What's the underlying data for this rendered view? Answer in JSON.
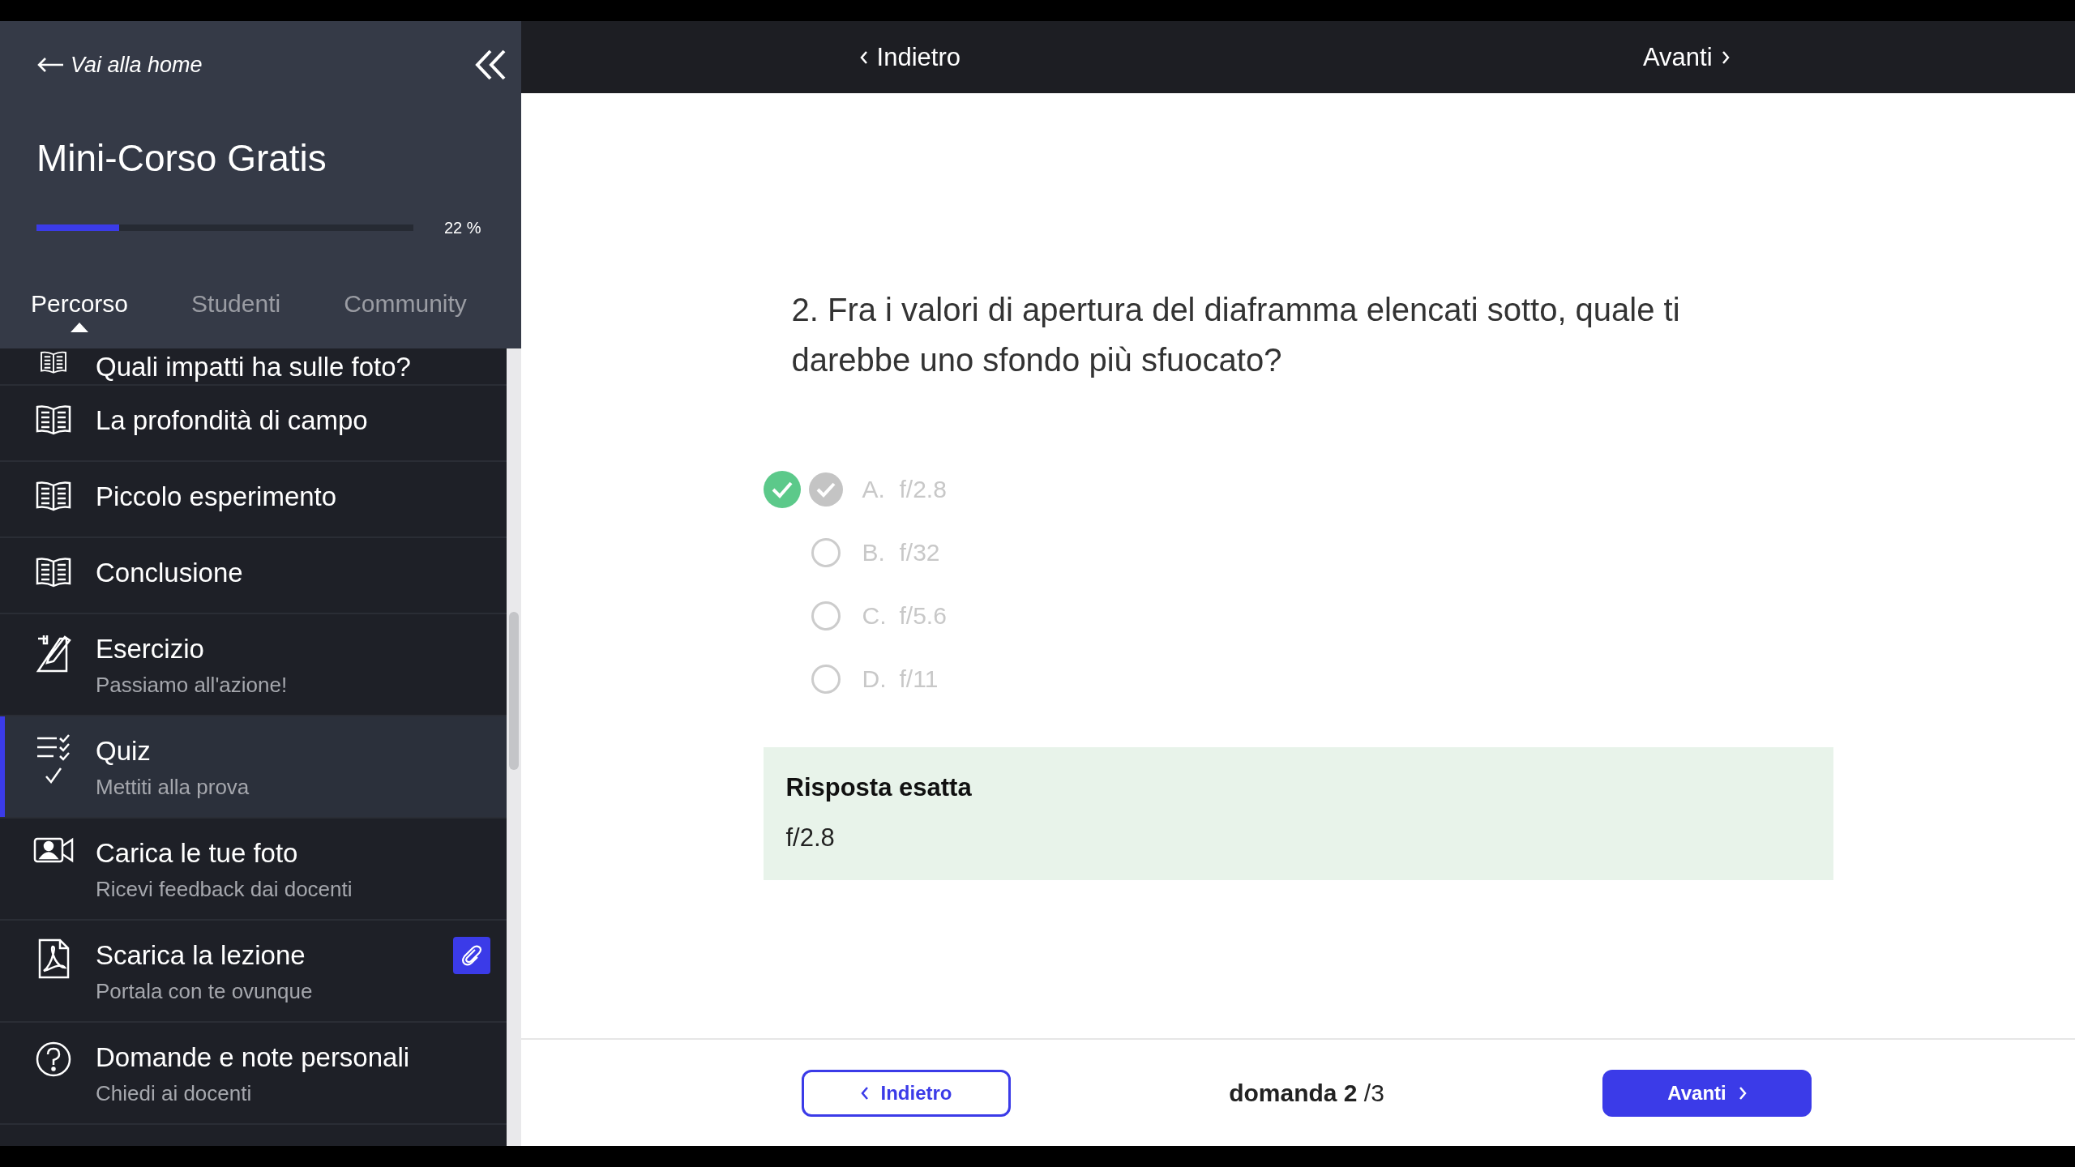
{
  "sidebar": {
    "home_link": "Vai alla home",
    "course_title": "Mini-Corso Gratis",
    "progress": {
      "level": 0.22,
      "reading": "22 %"
    },
    "tabs": [
      {
        "label": "Percorso",
        "selected": true
      },
      {
        "label": "Studenti",
        "selected": false
      },
      {
        "label": "Community",
        "selected": false
      }
    ],
    "items": [
      {
        "kind": "lesson",
        "title": "Quali impatti ha sulle foto?",
        "selected": false
      },
      {
        "kind": "lesson",
        "title": "La profondità di campo",
        "selected": false
      },
      {
        "kind": "lesson",
        "title": "Piccolo esperimento",
        "selected": false
      },
      {
        "kind": "lesson",
        "title": "Conclusione",
        "selected": false
      },
      {
        "kind": "exercise",
        "title": "Esercizio",
        "subtitle": "Passiamo all'azione!",
        "selected": false
      },
      {
        "kind": "quiz",
        "title": "Quiz",
        "subtitle": "Mettiti alla prova",
        "selected": true,
        "completed": true
      },
      {
        "kind": "upload",
        "title": "Carica le tue foto",
        "subtitle": "Ricevi feedback dai docenti",
        "selected": false
      },
      {
        "kind": "download",
        "title": "Scarica la lezione",
        "subtitle": "Portala con te ovunque",
        "selected": false,
        "attachment": true
      },
      {
        "kind": "questions",
        "title": "Domande e note personali",
        "subtitle": "Chiedi ai docenti",
        "selected": false
      }
    ]
  },
  "top_nav": {
    "back": "Indietro",
    "next": "Avanti"
  },
  "question": {
    "text": "2. Fra i valori di apertura del diaframma elencati sotto, quale ti darebbe uno sfondo più sfuocato?",
    "options": [
      {
        "letter": "A.",
        "text": "f/2.8",
        "selected": true,
        "correct": true
      },
      {
        "letter": "B.",
        "text": "f/32",
        "selected": false,
        "correct": false
      },
      {
        "letter": "C.",
        "text": "f/5.6",
        "selected": false,
        "correct": false
      },
      {
        "letter": "D.",
        "text": "f/11",
        "selected": false,
        "correct": false
      }
    ],
    "feedback": {
      "title": "Risposta esatta",
      "answer": "f/2.8"
    }
  },
  "footer": {
    "back": "Indietro",
    "counter": "**domanda 2** /3",
    "next": "Avanti"
  }
}
